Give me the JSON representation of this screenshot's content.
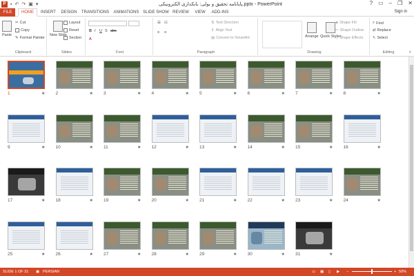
{
  "title_bar": {
    "app_icon": "P",
    "title": "پایانامه تحقیق و بولی: بانکداری الکترونیکی.pptx - PowerPoint",
    "help": "?",
    "minimize": "–",
    "restore": "❐",
    "close": "✕"
  },
  "tabs": [
    "FILE",
    "HOME",
    "INSERT",
    "DESIGN",
    "TRANSITIONS",
    "ANIMATIONS",
    "SLIDE SHOW",
    "REVIEW",
    "VIEW",
    "ADD-INS"
  ],
  "active_tab": "HOME",
  "sign_in": "Sign in",
  "ribbon": {
    "clipboard": {
      "label": "Clipboard",
      "paste": "Paste",
      "cut": "Cut",
      "copy": "Copy",
      "format_painter": "Format Painter"
    },
    "slides": {
      "label": "Slides",
      "new_slide": "New Slide",
      "layout": "Layout",
      "reset": "Reset",
      "section": "Section"
    },
    "font": {
      "label": "Font"
    },
    "paragraph": {
      "label": "Paragraph",
      "text_direction": "Text Direction",
      "align_text": "Align Text",
      "convert_smartart": "Convert to SmartArt"
    },
    "drawing": {
      "label": "Drawing",
      "arrange": "Arrange",
      "quick_styles": "Quick Styles",
      "shape_fill": "Shape Fill",
      "shape_outline": "Shape Outline",
      "shape_effects": "Shape Effects"
    },
    "editing": {
      "label": "Editing",
      "find": "Find",
      "replace": "Replace",
      "select": "Select"
    }
  },
  "slides": [
    {
      "num": "1",
      "style": "title1",
      "selected": true
    },
    {
      "num": "2",
      "style": "std"
    },
    {
      "num": "3",
      "style": "std"
    },
    {
      "num": "4",
      "style": "std"
    },
    {
      "num": "5",
      "style": "std"
    },
    {
      "num": "6",
      "style": "std"
    },
    {
      "num": "7",
      "style": "std"
    },
    {
      "num": "8",
      "style": "std"
    },
    {
      "num": "9",
      "style": "white"
    },
    {
      "num": "10",
      "style": "std"
    },
    {
      "num": "11",
      "style": "std"
    },
    {
      "num": "12",
      "style": "white"
    },
    {
      "num": "13",
      "style": "white"
    },
    {
      "num": "14",
      "style": "std"
    },
    {
      "num": "15",
      "style": "std"
    },
    {
      "num": "16",
      "style": "white"
    },
    {
      "num": "17",
      "style": "dark"
    },
    {
      "num": "18",
      "style": "white"
    },
    {
      "num": "19",
      "style": "std"
    },
    {
      "num": "20",
      "style": "std"
    },
    {
      "num": "21",
      "style": "white"
    },
    {
      "num": "22",
      "style": "white"
    },
    {
      "num": "23",
      "style": "white"
    },
    {
      "num": "24",
      "style": "std"
    },
    {
      "num": "25",
      "style": "white"
    },
    {
      "num": "26",
      "style": "white"
    },
    {
      "num": "27",
      "style": "std"
    },
    {
      "num": "28",
      "style": "std"
    },
    {
      "num": "29",
      "style": "std"
    },
    {
      "num": "30",
      "style": "tech"
    },
    {
      "num": "31",
      "style": "dark"
    }
  ],
  "status": {
    "slide_info": "SLIDE 1 OF 31",
    "language": "PERSIAN",
    "zoom": "50%",
    "zoom_minus": "−",
    "zoom_plus": "+"
  },
  "colors": {
    "accent": "#d24726",
    "slide_band": "#3d5a2e"
  }
}
